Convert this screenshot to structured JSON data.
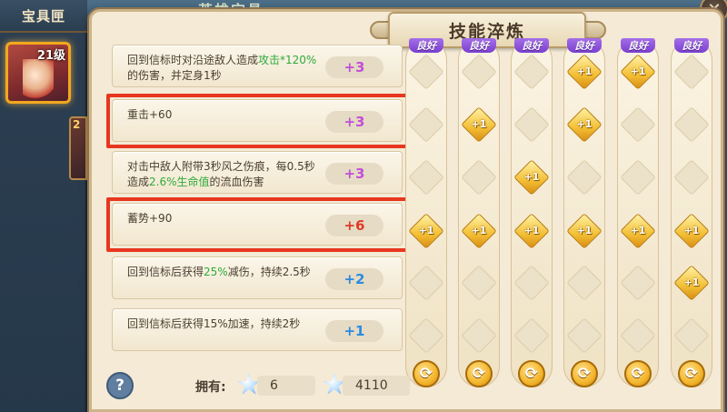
{
  "background": {
    "sidebar_title": "宝具匣",
    "selected_item_level": "21级",
    "ghost_title": "英雄宝具",
    "second_item_level": "2"
  },
  "dialog": {
    "title": "技能淬炼"
  },
  "attributes": [
    {
      "text_parts": [
        {
          "t": "回到信标时对沿途敌人造成"
        },
        {
          "t": "攻击*120%",
          "hl": true
        },
        {
          "t": "的伤害，并定身1秒"
        }
      ],
      "value": "+3",
      "value_color": "purple",
      "highlighted": false
    },
    {
      "text_parts": [
        {
          "t": "重击+60"
        }
      ],
      "value": "+3",
      "value_color": "purple",
      "highlighted": true
    },
    {
      "text_parts": [
        {
          "t": "对击中敌人附带3秒风之伤痕，每0.5秒造成"
        },
        {
          "t": "2.6%生命值",
          "hl": true
        },
        {
          "t": "的流血伤害"
        }
      ],
      "value": "+3",
      "value_color": "purple",
      "highlighted": false
    },
    {
      "text_parts": [
        {
          "t": "蓄势+90"
        }
      ],
      "value": "+6",
      "value_color": "red",
      "highlighted": true
    },
    {
      "text_parts": [
        {
          "t": "回到信标后获得"
        },
        {
          "t": "25%",
          "hl": true
        },
        {
          "t": "减伤，持续2.5秒"
        }
      ],
      "value": "+2",
      "value_color": "blue",
      "highlighted": false
    },
    {
      "text_parts": [
        {
          "t": "回到信标后获得15%加速，持续2秒"
        }
      ],
      "value": "+1",
      "value_color": "blue",
      "highlighted": false
    }
  ],
  "columns": [
    {
      "tag": "良好",
      "slots": [
        "",
        "",
        "",
        "+1",
        "",
        ""
      ]
    },
    {
      "tag": "良好",
      "slots": [
        "",
        "+1",
        "",
        "+1",
        "",
        ""
      ]
    },
    {
      "tag": "良好",
      "slots": [
        "",
        "",
        "+1",
        "+1",
        "",
        ""
      ]
    },
    {
      "tag": "良好",
      "slots": [
        "+1",
        "+1",
        "",
        "+1",
        "",
        ""
      ]
    },
    {
      "tag": "良好",
      "slots": [
        "+1",
        "",
        "",
        "+1",
        "",
        ""
      ]
    },
    {
      "tag": "良好",
      "slots": [
        "",
        "",
        "",
        "+1",
        "+1",
        ""
      ]
    }
  ],
  "bottom": {
    "help_icon": "?",
    "own_label": "拥有:",
    "stone_small_count": "6",
    "stone_large_count": "4110"
  },
  "icons": {
    "refresh": "refresh-icon",
    "help": "help-icon",
    "close": "close-icon"
  }
}
